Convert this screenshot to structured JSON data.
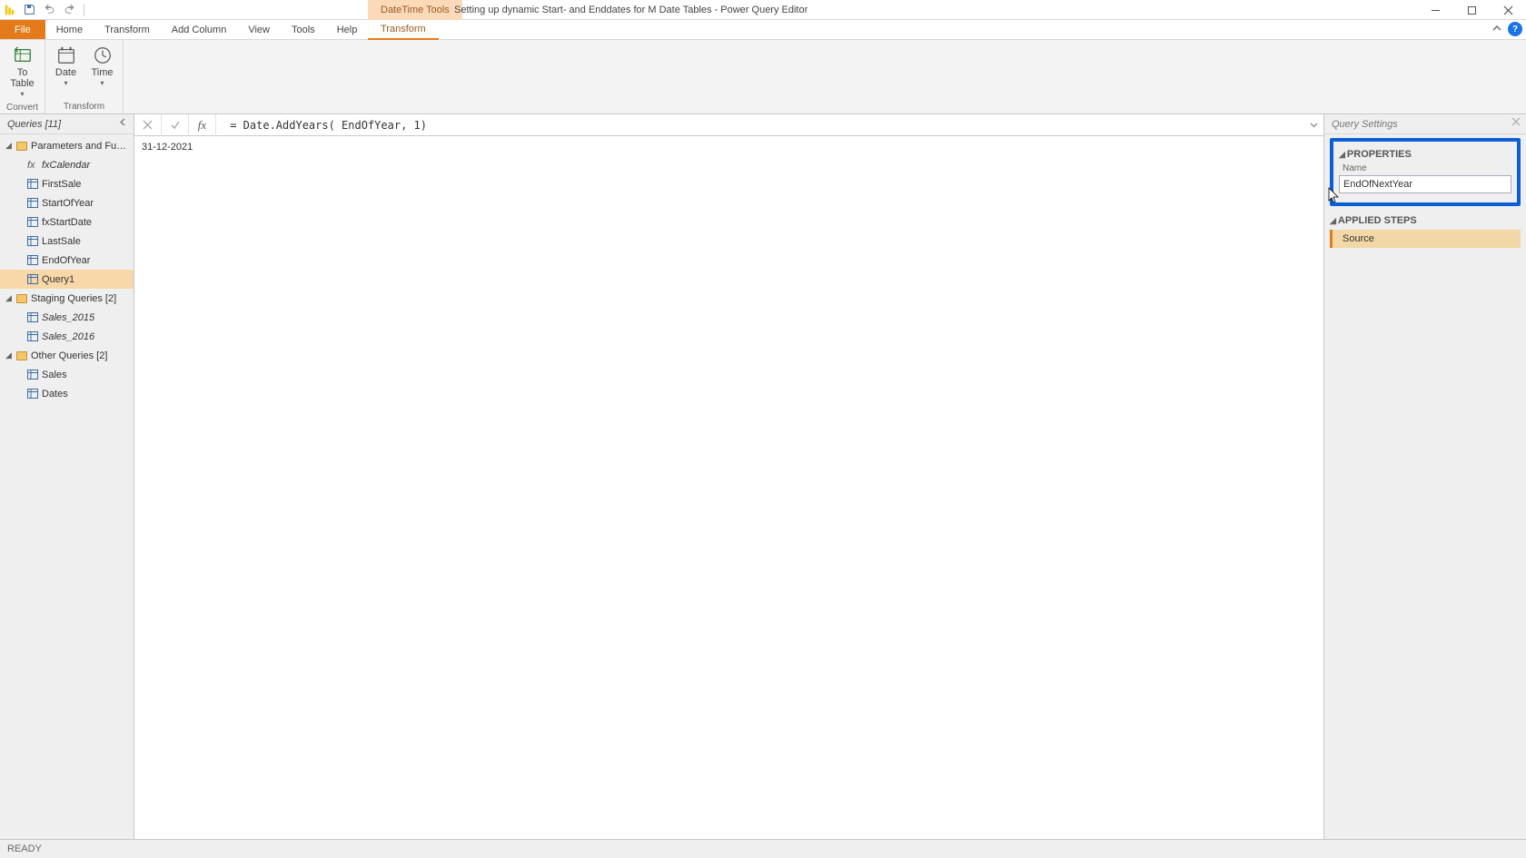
{
  "titlebar": {
    "context_tab": "DateTime Tools",
    "document_title": "Setting up dynamic Start- and Enddates for M Date Tables - Power Query Editor"
  },
  "ribbon_tabs": {
    "file": "File",
    "items": [
      "Home",
      "Transform",
      "Add Column",
      "View",
      "Tools",
      "Help"
    ],
    "context": "Transform"
  },
  "ribbon": {
    "groups": [
      {
        "caption": "Convert",
        "buttons": [
          {
            "label": "To Table",
            "dropdown": true,
            "icon": "to-table"
          }
        ]
      },
      {
        "caption": "Transform",
        "buttons": [
          {
            "label": "Date",
            "dropdown": true,
            "icon": "date"
          },
          {
            "label": "Time",
            "dropdown": true,
            "icon": "time"
          }
        ]
      }
    ]
  },
  "queries_pane": {
    "header": "Queries [11]",
    "tree": [
      {
        "type": "folder",
        "label": "Parameters and Fu…",
        "expanded": true,
        "children": [
          {
            "type": "fx",
            "label": "fxCalendar",
            "italic": true
          },
          {
            "type": "table",
            "label": "FirstSale"
          },
          {
            "type": "table",
            "label": "StartOfYear"
          },
          {
            "type": "table",
            "label": "fxStartDate"
          },
          {
            "type": "table",
            "label": "LastSale"
          },
          {
            "type": "table",
            "label": "EndOfYear"
          },
          {
            "type": "table",
            "label": "Query1",
            "selected": true
          }
        ]
      },
      {
        "type": "folder",
        "label": "Staging Queries [2]",
        "expanded": true,
        "children": [
          {
            "type": "table",
            "label": "Sales_2015",
            "italic": true
          },
          {
            "type": "table",
            "label": "Sales_2016",
            "italic": true
          }
        ]
      },
      {
        "type": "folder",
        "label": "Other Queries [2]",
        "expanded": true,
        "children": [
          {
            "type": "table",
            "label": "Sales"
          },
          {
            "type": "table",
            "label": "Dates"
          }
        ]
      }
    ]
  },
  "formula_bar": {
    "value": " = Date.AddYears( EndOfYear, 1)"
  },
  "data_preview": {
    "scalar_value": "31-12-2021"
  },
  "query_settings": {
    "header": "Query Settings",
    "properties_title": "PROPERTIES",
    "name_label": "Name",
    "name_value": "EndOfNextYear",
    "applied_steps_title": "APPLIED STEPS",
    "steps": [
      {
        "label": "Source",
        "selected": true
      }
    ]
  },
  "statusbar": {
    "text": "READY"
  }
}
